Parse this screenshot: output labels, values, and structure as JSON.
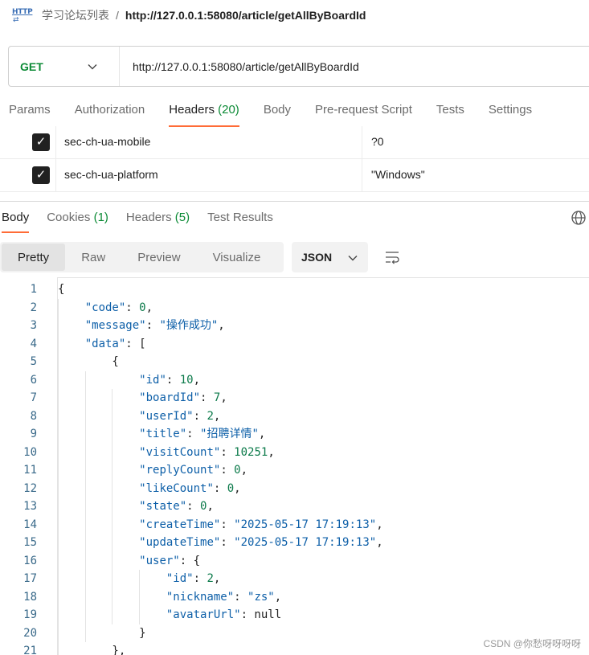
{
  "breadcrumb": {
    "icon_text": "HTTP",
    "parent": "学习论坛列表",
    "separator": "/",
    "current": "http://127.0.0.1:58080/article/getAllByBoardId"
  },
  "request": {
    "method": "GET",
    "url": "http://127.0.0.1:58080/article/getAllByBoardId"
  },
  "request_tabs": [
    {
      "label": "Params",
      "count": ""
    },
    {
      "label": "Authorization",
      "count": ""
    },
    {
      "label": "Headers",
      "count": "(20)"
    },
    {
      "label": "Body",
      "count": ""
    },
    {
      "label": "Pre-request Script",
      "count": ""
    },
    {
      "label": "Tests",
      "count": ""
    },
    {
      "label": "Settings",
      "count": ""
    }
  ],
  "header_rows": [
    {
      "key": "sec-ch-ua-mobile",
      "value": "?0",
      "checked": true
    },
    {
      "key": "sec-ch-ua-platform",
      "value": "\"Windows\"",
      "checked": true
    }
  ],
  "response_tabs": [
    {
      "label": "Body",
      "count": ""
    },
    {
      "label": "Cookies",
      "count": "(1)"
    },
    {
      "label": "Headers",
      "count": "(5)"
    },
    {
      "label": "Test Results",
      "count": ""
    }
  ],
  "format_options": [
    "Pretty",
    "Raw",
    "Preview",
    "Visualize"
  ],
  "format_active": "Pretty",
  "language": "JSON",
  "code_lines": [
    "{",
    "    \"code\": 0,",
    "    \"message\": \"操作成功\",",
    "    \"data\": [",
    "        {",
    "            \"id\": 10,",
    "            \"boardId\": 7,",
    "            \"userId\": 2,",
    "            \"title\": \"招聘详情\",",
    "            \"visitCount\": 10251,",
    "            \"replyCount\": 0,",
    "            \"likeCount\": 0,",
    "            \"state\": 0,",
    "            \"createTime\": \"2025-05-17 17:19:13\",",
    "            \"updateTime\": \"2025-05-17 17:19:13\",",
    "            \"user\": {",
    "                \"id\": 2,",
    "                \"nickname\": \"zs\",",
    "                \"avatarUrl\": null",
    "            }",
    "        },"
  ],
  "watermark": "CSDN @你愁呀呀呀呀",
  "colors": {
    "accent": "#ff6c37",
    "method_get": "#0b8a35",
    "json_key": "#0d5fa8",
    "json_number": "#0b7a4a"
  },
  "icons": [
    "http-icon",
    "chevron-down-icon",
    "checkbox-checked-icon",
    "globe-icon",
    "wrap-lines-icon"
  ]
}
